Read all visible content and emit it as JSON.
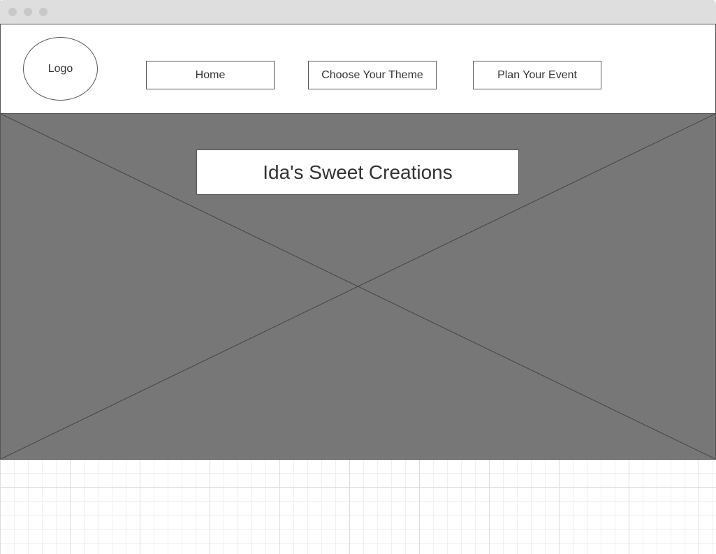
{
  "window": {
    "controls": [
      "close-dot",
      "minimize-dot",
      "maximize-dot"
    ]
  },
  "header": {
    "logo_label": "Logo",
    "nav": [
      {
        "label": "Home"
      },
      {
        "label": "Choose Your Theme"
      },
      {
        "label": "Plan Your Event"
      }
    ]
  },
  "hero": {
    "title": "Ida's Sweet Creations",
    "placeholder": "image-placeholder"
  },
  "colors": {
    "hero_background": "#777777",
    "border": "#555555",
    "text": "#333333",
    "titlebar": "#dedede"
  }
}
